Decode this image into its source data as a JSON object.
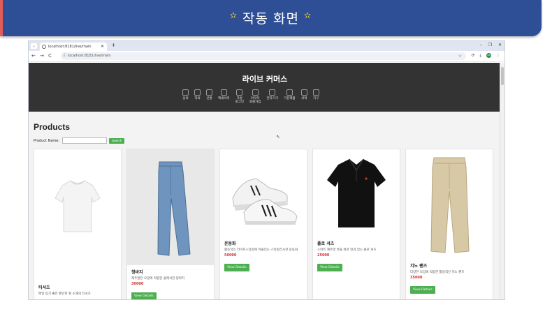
{
  "slide": {
    "title": "작동 화면",
    "star_left": "✫",
    "star_right": "✫"
  },
  "browser": {
    "tab_title": "localhost:8181/live/main",
    "tab_menu": "⌄",
    "new_tab": "+",
    "window_controls": "– ❐ ✕",
    "nav_buttons": "← → C",
    "url": "localhost:8181/live/main",
    "url_info_icon": "info-icon",
    "bookmark": "☆",
    "tools": "⟳ ⤓",
    "avatar_text": "NS",
    "menu": "⋮"
  },
  "site": {
    "title": "라이브 커머스",
    "categories": [
      {
        "label": "상의"
      },
      {
        "label": "하의"
      },
      {
        "label": "신발"
      },
      {
        "label": "액세서리"
      },
      {
        "label": "가방\n로그인"
      },
      {
        "label": "아우터\n회원가입"
      },
      {
        "label": "전자기기"
      },
      {
        "label": "가전제품"
      },
      {
        "label": "서적"
      },
      {
        "label": "가구"
      }
    ]
  },
  "products_page": {
    "heading": "Products",
    "search_label": "Product Name:",
    "search_placeholder": "",
    "search_button": "Search"
  },
  "products": [
    {
      "name": "티셔츠",
      "desc": "매일 입기 좋은 편안한 흰 소재의 티셔츠",
      "price": "",
      "button": ""
    },
    {
      "name": "청바지",
      "desc": "캐주얼한 모임에 적합한 클래식한 청바지",
      "price": "30000",
      "button": "View Details"
    },
    {
      "name": "운동화",
      "desc": "활동적인 라이프스타일에 어울리는 스타일리시한 운동화",
      "price": "50000",
      "button": "View Details"
    },
    {
      "name": "폴로 셔츠",
      "desc": "스마트 캐주얼 룩을 위한 멋과 있는 폴로 셔츠",
      "price": "25000",
      "button": "View Details"
    },
    {
      "name": "치노 팬츠",
      "desc": "다양한 모임에 적합한 활용적인 치노 팬츠",
      "price": "35000",
      "button": "View Details"
    }
  ],
  "colors": {
    "banner": "#2e4f95",
    "header": "#333333",
    "accent_green": "#4caf50",
    "price_red": "#d63031"
  }
}
